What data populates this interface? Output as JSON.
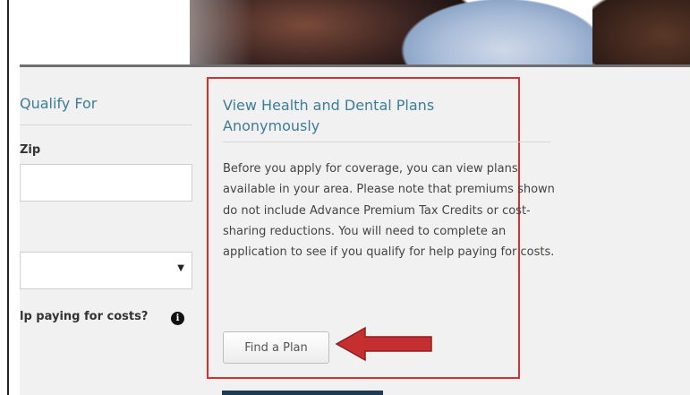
{
  "qualify": {
    "heading": "Qualify For",
    "zip_label": "Zip",
    "zip_value": "",
    "select_value": "",
    "help_label": "lp paying for costs?"
  },
  "plans": {
    "title": "View Health and Dental Plans Anonymously",
    "body": "Before you apply for coverage, you can view plans available in your area. Please note that premiums shown do not include Advance Premium Tax Credits or cost-sharing reductions. You will need to complete an application to see if you qualify for help paying for costs.",
    "button_label": "Find a Plan"
  },
  "icons": {
    "info": "info-icon",
    "caret": "chevron-down-icon",
    "arrow": "arrow-left-icon"
  },
  "colors": {
    "heading": "#3c7d9a",
    "highlight": "#d92f2f",
    "content_bg": "#f1f1f1"
  }
}
